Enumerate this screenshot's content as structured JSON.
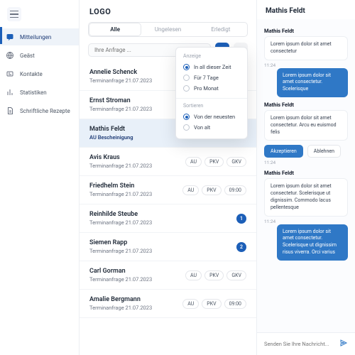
{
  "sidebar": {
    "items": [
      {
        "label": "Mitteilungen",
        "icon": "chat"
      },
      {
        "label": "Geäst",
        "icon": "globe"
      },
      {
        "label": "Kontakte",
        "icon": "card"
      },
      {
        "label": "Statistiken",
        "icon": "stats"
      },
      {
        "label": "Schriftliche Rezepte",
        "icon": "doc"
      }
    ],
    "active": 0
  },
  "logo": "LOGO",
  "tabs": [
    "Alle",
    "Ungelesen",
    "Erledigt"
  ],
  "tabs_active": 0,
  "search_placeholder": "Ihre Anfrage ...",
  "filter_popup": {
    "section1_title": "Anzeige",
    "section1_opts": [
      "In all dieser Zeit",
      "Für 7 Tage",
      "Pro Monat"
    ],
    "section1_sel": 0,
    "section2_title": "Sortieren",
    "section2_opts": [
      "Von der neuesten",
      "Von alt"
    ],
    "section2_sel": 0
  },
  "list": [
    {
      "name": "Annelie Schenck",
      "sub": "Terminanfrage 21.07.2023"
    },
    {
      "name": "Ernst Stroman",
      "sub": "Terminanfrage 21.07.2023"
    },
    {
      "name": "Mathis Feldt",
      "sub": "AU Bescheinigung",
      "selected": true
    },
    {
      "name": "Avis Kraus",
      "sub": "Terminanfrage 21.07.2023",
      "pills": [
        "AU",
        "PKV",
        "GKV"
      ]
    },
    {
      "name": "Friedhelm Stein",
      "sub": "Terminanfrage 21.07.2023",
      "pills": [
        "AU",
        "PKV",
        "09:00"
      ]
    },
    {
      "name": "Reinhilde Steube",
      "sub": "Terminanfrage 21.07.2023",
      "badge": "1"
    },
    {
      "name": "Siemen Rapp",
      "sub": "Terminanfrage 21.07.2023",
      "badge": "2"
    },
    {
      "name": "Carl Gorman",
      "sub": "Terminanfrage 21.07.2023",
      "pills": [
        "AU",
        "PKV",
        "GKV"
      ]
    },
    {
      "name": "Amalie Bergmann",
      "sub": "Terminanfrage 21.07.2023",
      "pills": [
        "AU",
        "PKV",
        "09:00"
      ]
    }
  ],
  "chat": {
    "header": "Mathis Feldt",
    "messages": [
      {
        "from": "Mathis Feldt",
        "text": "Lorem ipsum dolor sit amet consectetur",
        "ts": "11:24"
      },
      {
        "blue": true,
        "text": "Lorem ipsum dolor sit amet consectetur. Scelerisque"
      },
      {
        "from": "Mathis Feldt",
        "text": "Lorem ipsum dolor sit amet consectetur. Arcu eu euismod felis",
        "ts": "11:24",
        "actions": true
      },
      {
        "from": "Mathis Feldt",
        "text": "Lorem ipsum dolor sit amet consectetur. Scelerisque ut dignissim. Commodo lacus pellentesque",
        "ts": "11:24"
      },
      {
        "blue": true,
        "text": "Lorem ipsum dolor sit amet consectetur. Scelerisque ut dignissim risus viverra. Orci varius"
      }
    ],
    "accept": "Akzeptieren",
    "decline": "Ablehnen",
    "composer_placeholder": "Senden Sie Ihre Nachricht..."
  }
}
